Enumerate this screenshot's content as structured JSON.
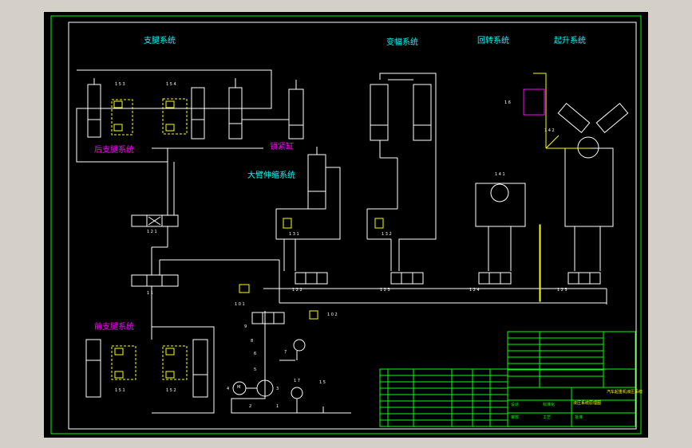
{
  "titles": {
    "support_system": "支腿系统",
    "luffing_system": "变幅系统",
    "slewing_system": "回转系统",
    "hoisting_system": "起升系统",
    "rear_support": "后支腿系统",
    "front_support": "前支腿系统",
    "locking_cylinder": "锁紧缸",
    "boom_telescoping": "大臂伸缩系统"
  },
  "component_labels": {
    "c153": "1 5 3",
    "c154": "1 5 4",
    "c151": "1 5 1",
    "c152": "1 5 2",
    "c121": "1 2 1",
    "c11": "1 1",
    "c122": "1 2 2",
    "c123": "1 2 3",
    "c124": "1 2 4",
    "c125": "1 2 5",
    "c131": "1 3 1",
    "c132": "1 3 2",
    "c101": "1 0 1",
    "c102": "1 0 2",
    "c141": "1 4 1",
    "c142": "1 4 2",
    "c16": "1 6",
    "c9": "9",
    "c8": "8",
    "c7": "7",
    "c6": "6",
    "c5": "5",
    "c4": "4",
    "c3": "3",
    "c2": "2",
    "c1": "1",
    "c17": "1 7",
    "c15": "1 5",
    "motor": "M"
  },
  "title_block": {
    "drawing_title": "液压系统原理图",
    "sheet_name": "汽车起重机液压系统",
    "designer_col": "设计",
    "standard_col": "标准化",
    "review_col": "审核",
    "process_col": "工艺",
    "approve_col": "批准"
  },
  "colors": {
    "sheet_background": "#000000",
    "window_background": "#d4d0c8",
    "frame": "#00ff00",
    "lines": "#ffffff",
    "annotation": "#00ffff",
    "highlight": "#ff00ff",
    "valves": "#ffff00"
  }
}
